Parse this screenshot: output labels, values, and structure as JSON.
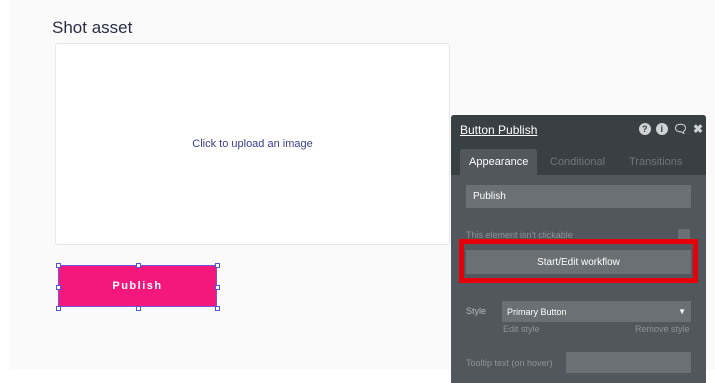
{
  "page": {
    "title": "Shot asset"
  },
  "uploader": {
    "label": "Click to upload an image"
  },
  "canvas_button": {
    "label": "Publish"
  },
  "panel": {
    "title": "Button Publish",
    "icons": [
      "help-icon",
      "info-icon",
      "comment-icon",
      "close-icon"
    ],
    "tabs": [
      {
        "label": "Appearance",
        "active": true
      },
      {
        "label": "Conditional",
        "active": false
      },
      {
        "label": "Transitions",
        "active": false
      }
    ],
    "text_value": "Publish",
    "not_clickable_label": "This element isn't clickable",
    "workflow_button": "Start/Edit workflow",
    "style_label": "Style",
    "style_value": "Primary Button",
    "edit_style": "Edit style",
    "remove_style": "Remove style",
    "tooltip_label": "Tooltip text (on hover)",
    "tooltip_value": ""
  },
  "colors": {
    "publish_button": "#f4177c",
    "panel_bg": "#51575c",
    "panel_header": "#394043",
    "highlight": "#e5000a"
  }
}
